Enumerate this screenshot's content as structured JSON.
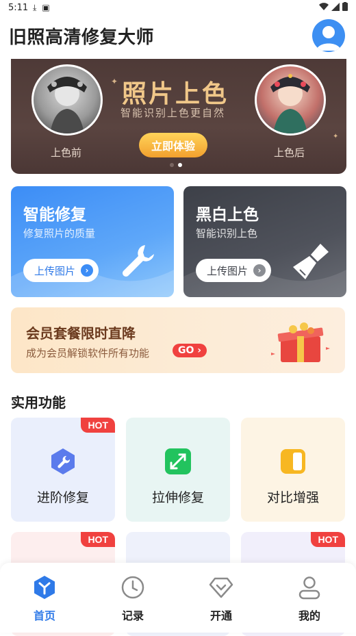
{
  "status_bar": {
    "time": "5:11"
  },
  "header": {
    "title": "旧照高清修复大师"
  },
  "banner": {
    "title": "照片上色",
    "subtitle": "智能识别上色更自然",
    "cta": "立即体验",
    "before_label": "上色前",
    "after_label": "上色后"
  },
  "cards": [
    {
      "title": "智能修复",
      "subtitle": "修复照片的质量",
      "button": "上传图片"
    },
    {
      "title": "黑白上色",
      "subtitle": "智能识别上色",
      "button": "上传图片"
    }
  ],
  "member": {
    "title": "会员套餐限时直降",
    "subtitle": "成为会员解锁软件所有功能",
    "go": "GO"
  },
  "section": {
    "title": "实用功能"
  },
  "features": [
    {
      "label": "进阶修复",
      "hot": "HOT",
      "icon": "wrench-hex-icon"
    },
    {
      "label": "拉伸修复",
      "icon": "expand-arrows-icon"
    },
    {
      "label": "对比增强",
      "icon": "contrast-icon"
    }
  ],
  "features_row2": [
    {
      "hot": "HOT"
    },
    {},
    {
      "hot": "HOT"
    }
  ],
  "tabbar": {
    "items": [
      {
        "label": "首页",
        "icon": "home-cube-icon",
        "active": true
      },
      {
        "label": "记录",
        "icon": "clock-icon"
      },
      {
        "label": "开通",
        "icon": "diamond-icon"
      },
      {
        "label": "我的",
        "icon": "person-icon"
      }
    ]
  },
  "colors": {
    "accent": "#2f7ae8",
    "hot": "#f0413f",
    "banner_gold": "#f0c789"
  }
}
